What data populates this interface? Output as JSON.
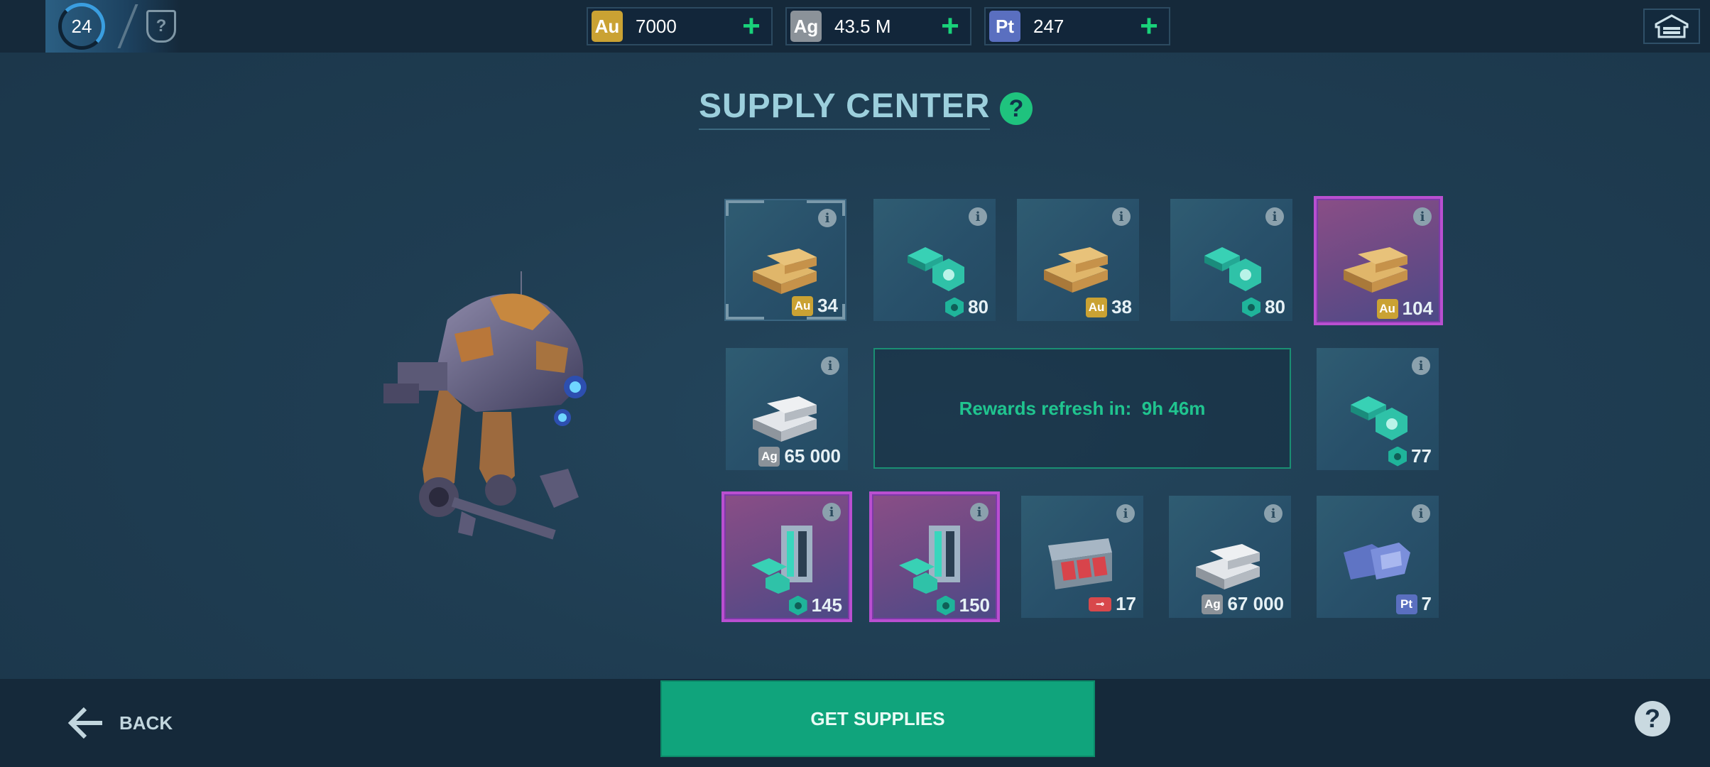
{
  "header": {
    "level": "24",
    "rank_icon": "?",
    "currencies": [
      {
        "code": "Au",
        "value": "7000",
        "color": "#caa233"
      },
      {
        "code": "Ag",
        "value": "43.5 M",
        "color": "#8b9299"
      },
      {
        "code": "Pt",
        "value": "247",
        "color": "#5a6fc0"
      }
    ],
    "plus": "+"
  },
  "title": "SUPPLY CENTER",
  "help": "?",
  "rewards": [
    {
      "type": "gold",
      "badge": "Au",
      "amount": "34",
      "rarity": "common",
      "selected": true
    },
    {
      "type": "components",
      "badge": "hex",
      "amount": "80",
      "rarity": "common"
    },
    {
      "type": "gold",
      "badge": "Au",
      "amount": "38",
      "rarity": "common"
    },
    {
      "type": "components",
      "badge": "hex",
      "amount": "80",
      "rarity": "common"
    },
    {
      "type": "gold",
      "badge": "Au",
      "amount": "104",
      "rarity": "epic"
    },
    {
      "type": "silver",
      "badge": "Ag",
      "amount": "65 000",
      "rarity": "common"
    },
    {
      "type": "components",
      "badge": "hex",
      "amount": "77",
      "rarity": "common"
    },
    {
      "type": "components-case",
      "badge": "hex",
      "amount": "145",
      "rarity": "epic"
    },
    {
      "type": "components-case",
      "badge": "hex",
      "amount": "150",
      "rarity": "epic"
    },
    {
      "type": "key-chest",
      "badge": "key",
      "amount": "17",
      "rarity": "common"
    },
    {
      "type": "silver",
      "badge": "Ag",
      "amount": "67 000",
      "rarity": "common"
    },
    {
      "type": "platinum",
      "badge": "Pt",
      "amount": "7",
      "rarity": "common"
    }
  ],
  "info_glyph": "i",
  "refresh": {
    "label": "Rewards refresh in:",
    "time": "9h 46m"
  },
  "footer": {
    "back_label": "BACK",
    "get_supplies_label": "GET SUPPLIES",
    "help": "?"
  },
  "colors": {
    "accent_green": "#19d27a",
    "epic_border": "#b94fd0",
    "button_green": "#10a47c"
  }
}
